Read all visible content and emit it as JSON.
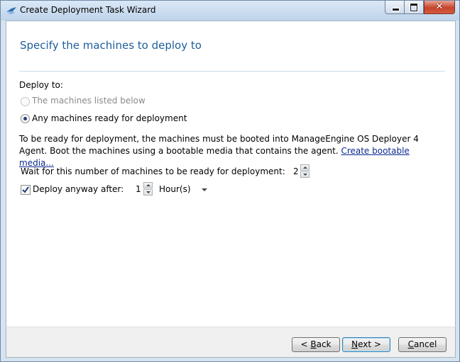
{
  "window": {
    "title": "Create Deployment Task Wizard",
    "close_glyph": "✕"
  },
  "page": {
    "heading": "Specify the machines to deploy to",
    "deploy_to_label": "Deploy to:",
    "option_listed": {
      "label": "The machines listed below",
      "selected": false,
      "enabled": false
    },
    "option_any": {
      "label": "Any machines ready for deployment",
      "selected": true,
      "enabled": true
    },
    "description": "To be ready for deployment, the machines must be booted into ManageEngine OS Deployer 4 Agent. Boot the machines using a bootable media that contains the agent.",
    "create_media_link": "Create bootable media...",
    "wait_label": "Wait for this number of machines to be ready for deployment:",
    "wait_value": "2",
    "deploy_anyway_label": "Deploy anyway after:",
    "deploy_anyway_checked": true,
    "deploy_anyway_value": "1",
    "unit_selected": "Hour(s)"
  },
  "footer": {
    "back": {
      "prefix": "< ",
      "mnemonic": "B",
      "rest": "ack"
    },
    "next": {
      "mnemonic": "N",
      "rest": "ext >"
    },
    "cancel": {
      "mnemonic": "C",
      "rest": "ancel"
    }
  },
  "colors": {
    "heading": "#1e5d9c",
    "link": "#0c2a8f",
    "default_button_border": "#3c7fb1"
  }
}
